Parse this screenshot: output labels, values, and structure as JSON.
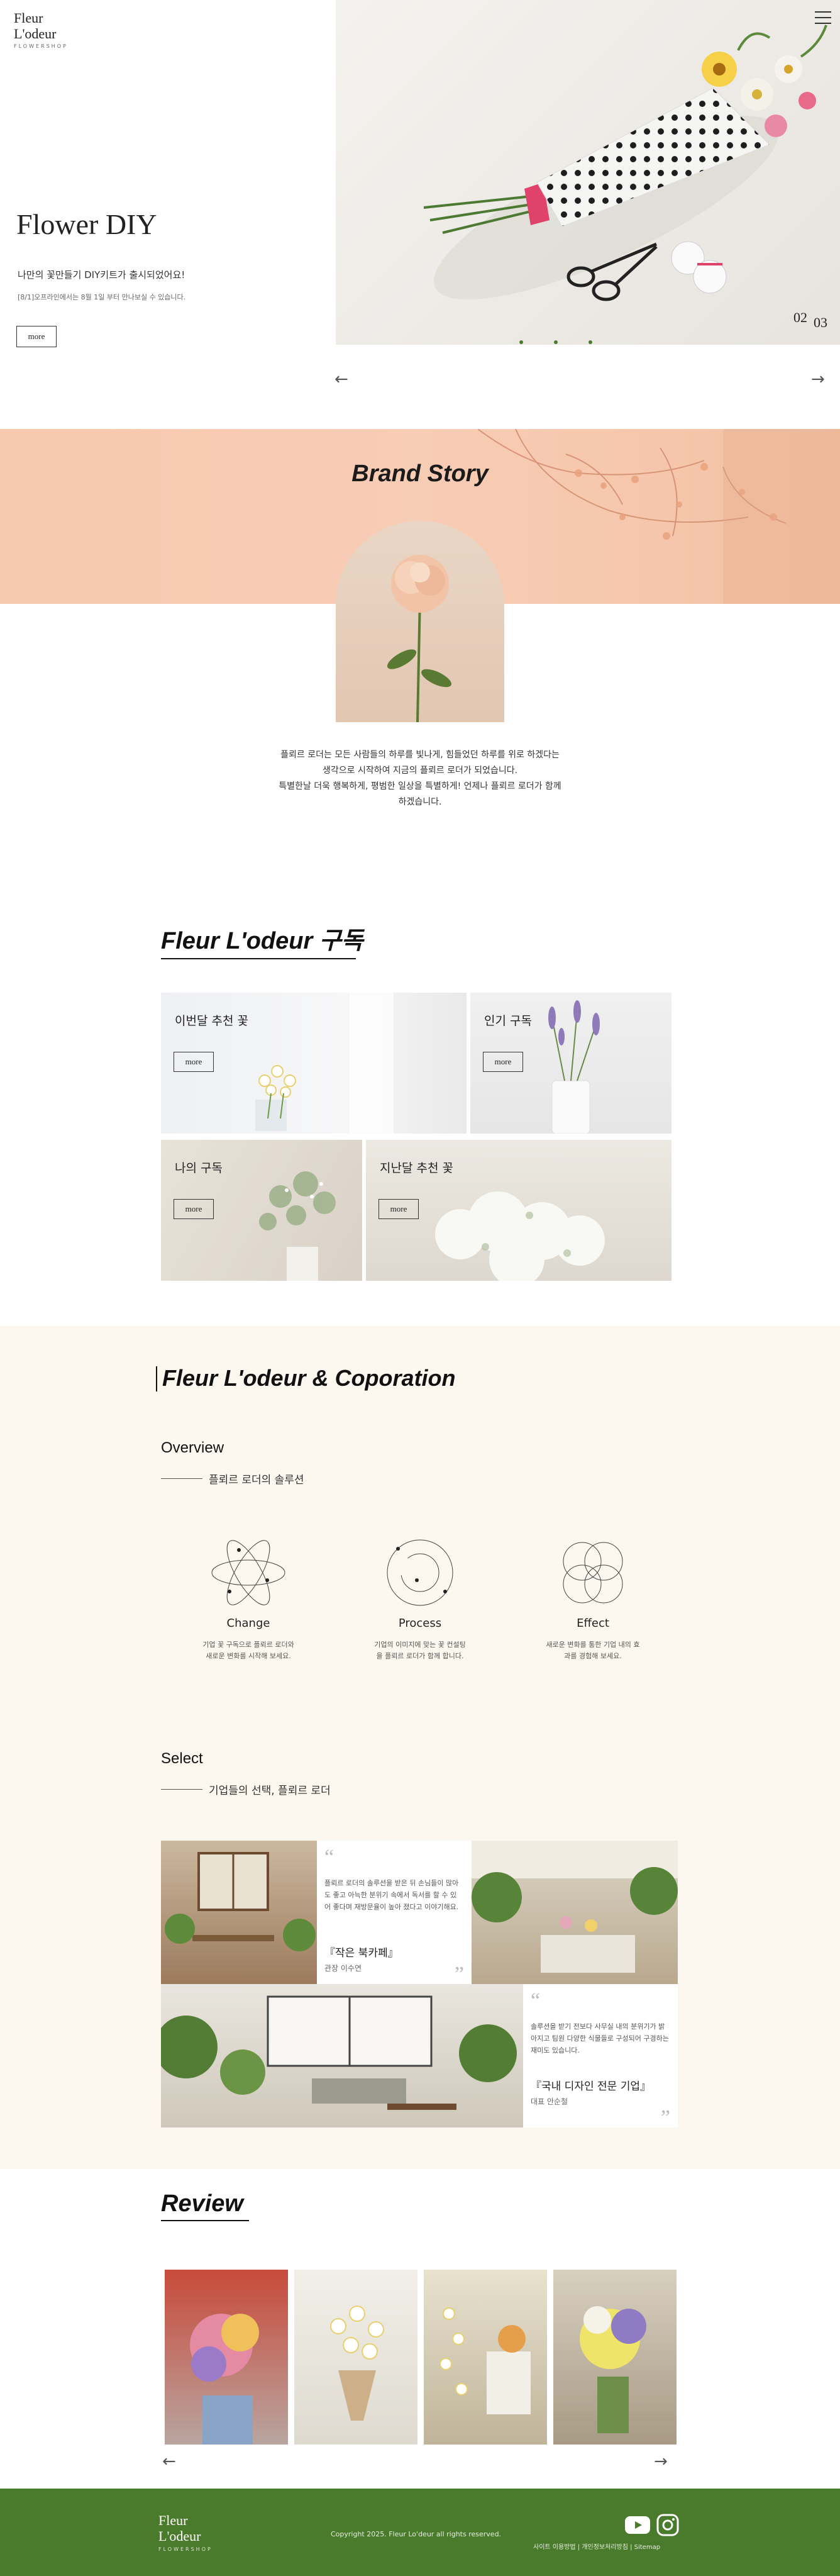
{
  "brand": {
    "line1": "Fleur",
    "line2": "L'odeur",
    "line3": "FLOWERSHOP"
  },
  "hero": {
    "title": "Flower DIY",
    "subtitle": "나만의 꽃만들기 DIY키트가 출시되었어요!",
    "note": "[8/1]오프라인에서는 8월 1일 부터 만나보실 수 있습니다.",
    "button": "more",
    "slide_current": "02",
    "slide_total": "03",
    "prev": "←",
    "next": "→"
  },
  "brand_story": {
    "title": "Brand Story",
    "lines": [
      "플뢰르 로더는 모든 사람들의 하루를 빛나게, 힘들었던 하루를 위로 하겠다는",
      "생각으로 시작하여 지금의 플뢰르 로더가 되었습니다.",
      "특별한날 더욱 행복하게, 평범한 일상을 특별하게! 언제나 플뢰르 로더가 함께",
      "하겠습니다."
    ]
  },
  "subscription": {
    "title": "Fleur L'odeur 구독",
    "cards": [
      {
        "title": "이번달 추천 꽃",
        "button": "more"
      },
      {
        "title": "인기 구독",
        "button": "more"
      },
      {
        "title": "나의 구독",
        "button": "more"
      },
      {
        "title": "지난달 추천 꽃",
        "button": "more"
      }
    ]
  },
  "coporation": {
    "title": "Fleur L'odeur & Coporation",
    "overview": {
      "heading": "Overview",
      "subtitle": "플뢰르 로더의 솔루션",
      "items": [
        {
          "name": "Change",
          "desc": "기업 꽃 구독으로 플뢰르 로더와 새로운 변화를 시작해 보세요.",
          "icon": "atom-icon"
        },
        {
          "name": "Process",
          "desc": "기업의 이미지에 맞는 꽃 컨설팅을 플뢰르 로더가 함께 합니다.",
          "icon": "cycle-icon"
        },
        {
          "name": "Effect",
          "desc": "새로운 변화를 통한 기업 내의 효과를 경험해 보세요.",
          "icon": "circles-icon"
        }
      ]
    },
    "select": {
      "heading": "Select",
      "subtitle": "기업들의 선택, 플뢰르 로더",
      "quotes": [
        {
          "text": "플뢰르 로더의 솔루션을 받은 뒤 손님들이 많아도 좋고 아늑한 분위기 속에서 독서를 할 수 있어 좋다며 재방문율이 높아 졌다고 이야기해요.",
          "name": "『작은 북카페』",
          "author": "관장 이수연"
        },
        {
          "text": "솔루션을 받기 전보다 사무실 내의 분위기가 밝아지고 팀원 다양한 식물들로 구성되어 구경하는 재미도 있습니다.",
          "name": "『국내 디자인 전문 기업』",
          "author": "대표 안순철"
        }
      ]
    }
  },
  "review": {
    "title": "Review",
    "prev": "←",
    "next": "→"
  },
  "footer": {
    "copyright": "Copyright 2025. Fleur Lo'deur all rights reserved.",
    "links": "사이트 이용방법 | 개인정보처리방침 | Sitemap",
    "icons": [
      "youtube-icon",
      "instagram-icon"
    ]
  },
  "colors": {
    "accent_green": "#4a7a2c",
    "peach": "#f7c9ae",
    "cream": "#fcf8ef"
  }
}
